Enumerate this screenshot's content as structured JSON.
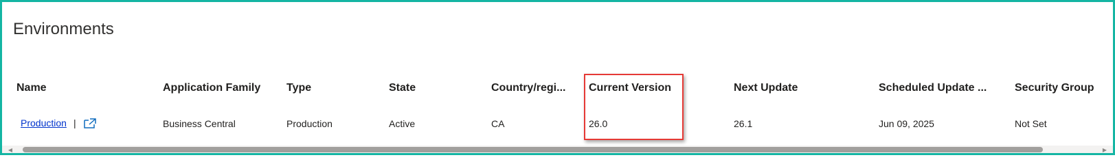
{
  "page": {
    "title": "Environments"
  },
  "table": {
    "headers": {
      "name": "Name",
      "application_family": "Application Family",
      "type": "Type",
      "state": "State",
      "country_region": "Country/regi...",
      "current_version": "Current Version",
      "next_update": "Next Update",
      "scheduled_update": "Scheduled Update ...",
      "security_group": "Security Group"
    },
    "rows": [
      {
        "name": "Production",
        "separator": "|",
        "application_family": "Business Central",
        "type": "Production",
        "state": "Active",
        "country_region": "CA",
        "current_version": "26.0",
        "next_update": "26.1",
        "scheduled_update": "Jun 09, 2025",
        "security_group": "Not Set"
      }
    ]
  },
  "icons": {
    "open_external": "open-in-new-window-icon",
    "scroll_left": "chevron-left-icon",
    "scroll_right": "chevron-right-icon"
  },
  "colors": {
    "frame_border": "#14b5a3",
    "highlight_border": "#e53935",
    "link": "#0033cc"
  }
}
